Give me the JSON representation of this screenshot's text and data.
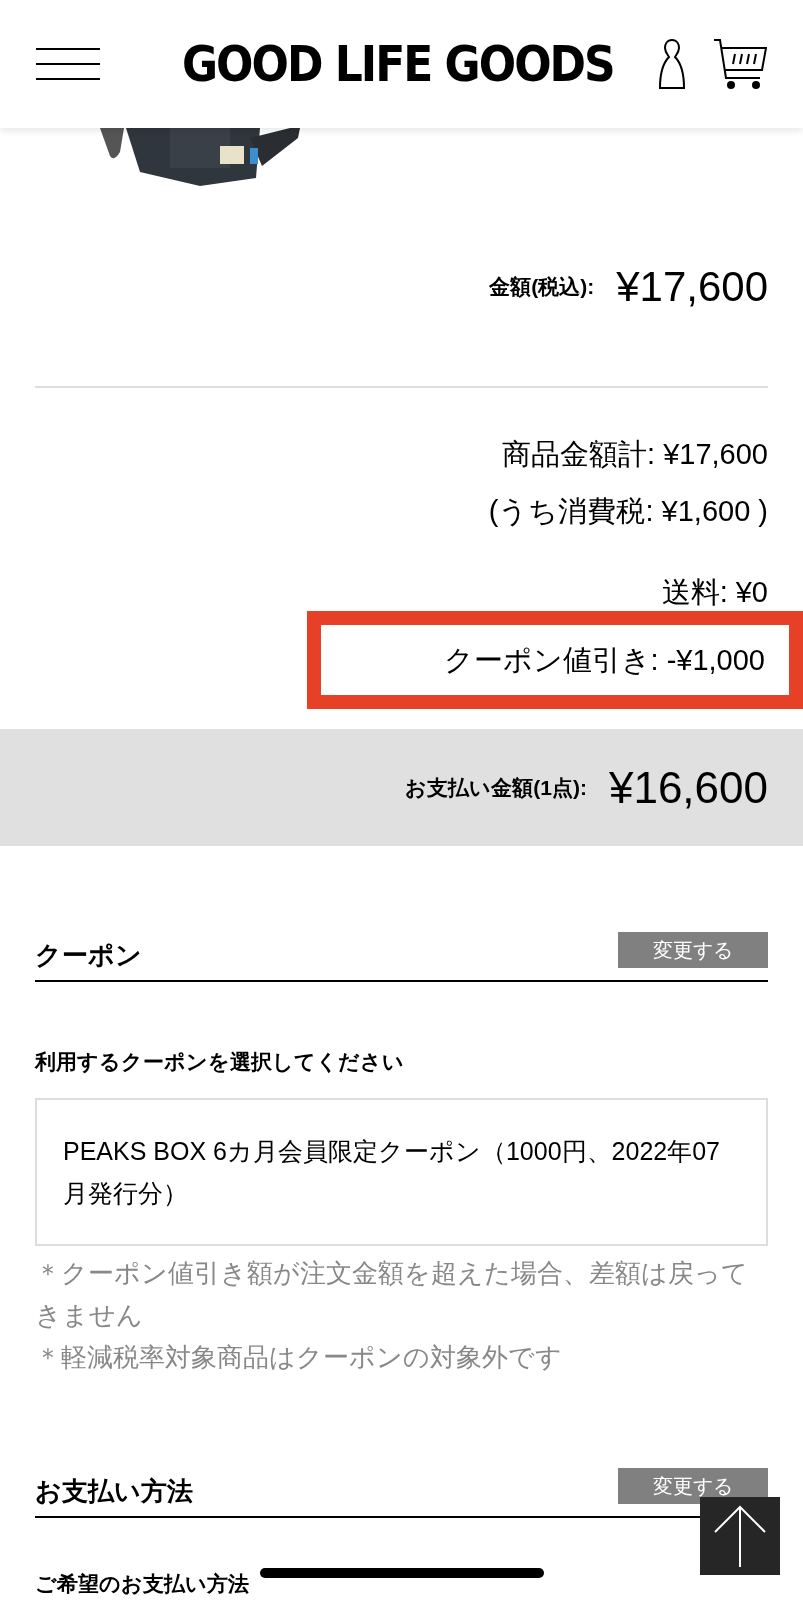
{
  "header": {
    "logo": "GOOD LIFE GOODS"
  },
  "price": {
    "label": "金額(税込):",
    "value": "¥17,600"
  },
  "summary": {
    "subtotal": "商品金額計: ¥17,600",
    "tax": "(うち消費税: ¥1,600 )",
    "shipping": "送料: ¥0",
    "coupon_discount": "クーポン値引き: -¥1,000",
    "highlighted": true
  },
  "total": {
    "label": "お支払い金額(1点):",
    "value": "¥16,600"
  },
  "coupon_section": {
    "title": "クーポン",
    "button": "変更する",
    "prompt": "利用するクーポンを選択してください",
    "selected_coupon": "PEAKS BOX 6カ月会員限定クーポン（1000円、2022年07月発行分）",
    "notes": [
      "＊クーポン値引き額が注文金額を超えた場合、差額は戻ってきません",
      "＊軽減税率対象商品はクーポンの対象外です"
    ]
  },
  "payment_section": {
    "title": "お支払い方法",
    "button": "変更する",
    "prompt": "ご希望のお支払い方法"
  }
}
